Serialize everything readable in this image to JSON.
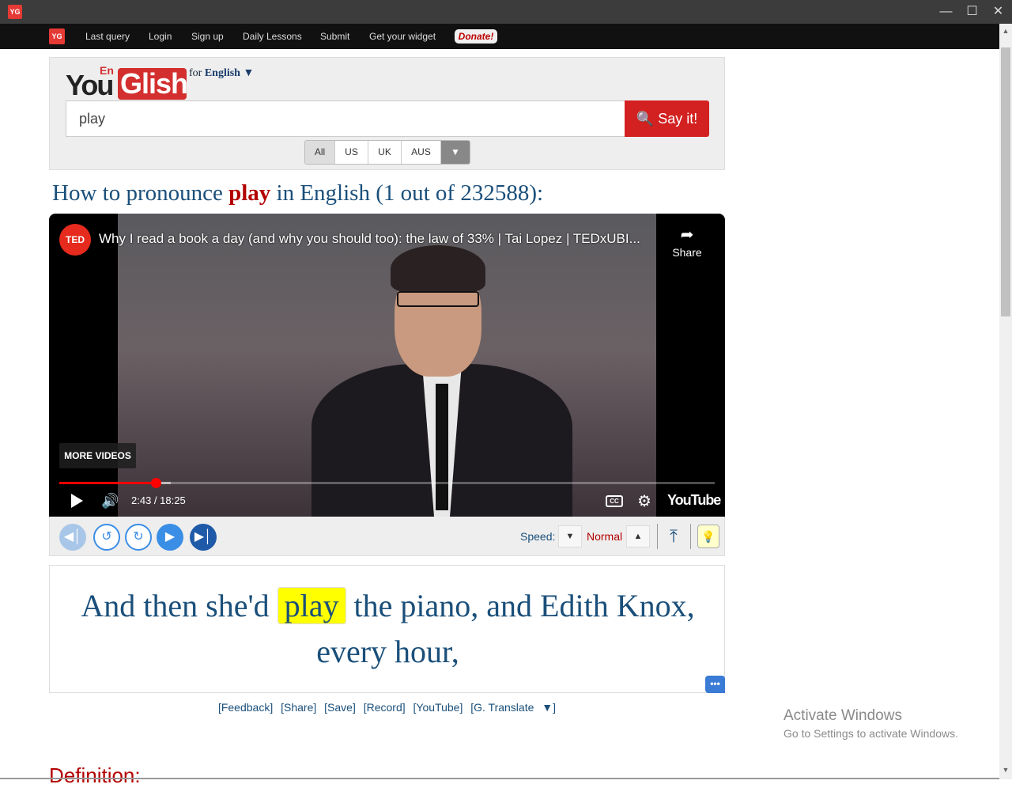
{
  "window": {
    "icon": "YG"
  },
  "nav": {
    "logo": "YG",
    "items": [
      "Last query",
      "Login",
      "Sign up",
      "Daily Lessons",
      "Submit",
      "Get your widget"
    ],
    "donate": "Donate!"
  },
  "brand": {
    "you": "You",
    "en": "En",
    "glish": "Glish",
    "for": "for",
    "language": "English ▼"
  },
  "search": {
    "value": "play",
    "button": "Say it!"
  },
  "accents": {
    "options": [
      "All",
      "US",
      "UK",
      "AUS"
    ],
    "selected": "All"
  },
  "heading": {
    "prefix": "How to pronounce ",
    "word": "play",
    "suffix": " in English (1 out of 232588):"
  },
  "video": {
    "channel": "TED",
    "title": "Why I read a book a day (and why you should too): the law of 33% | Tai Lopez | TEDxUBI...",
    "share": "Share",
    "more_videos": "MORE VIDEOS",
    "time": "2:43 / 18:25",
    "progress_fraction": 0.147,
    "loaded_fraction": 0.17,
    "youtube": "YouTube",
    "cc": "CC"
  },
  "controls": {
    "speed_label": "Speed:",
    "speed_value": "Normal"
  },
  "caption": {
    "before": "And then she'd ",
    "highlight": "play",
    "after": " the piano, and Edith Knox, every hour,"
  },
  "links": [
    "[Feedback]",
    "[Share]",
    "[Save]",
    "[Record]",
    "[YouTube]",
    "[G. Translate",
    "▼]"
  ],
  "definition": "Definition:",
  "watermark": {
    "line1": "Activate Windows",
    "line2": "Go to Settings to activate Windows."
  },
  "colors": {
    "accent_red": "#d32020",
    "link_blue": "#1a4f7a",
    "highlight": "#ffff00"
  }
}
